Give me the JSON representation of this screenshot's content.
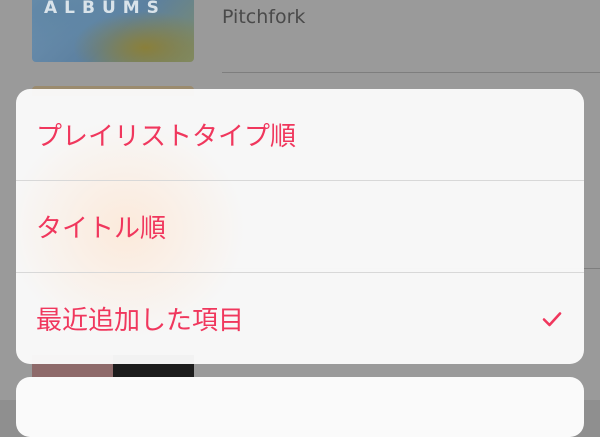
{
  "background": {
    "album_art_text": "ALBUMS",
    "album_subtitle": "Pitchfork"
  },
  "action_sheet": {
    "items": [
      {
        "label": "プレイリストタイプ順",
        "selected": false
      },
      {
        "label": "タイトル順",
        "selected": false
      },
      {
        "label": "最近追加した項目",
        "selected": true
      }
    ],
    "accent_color": "#f0375d"
  }
}
